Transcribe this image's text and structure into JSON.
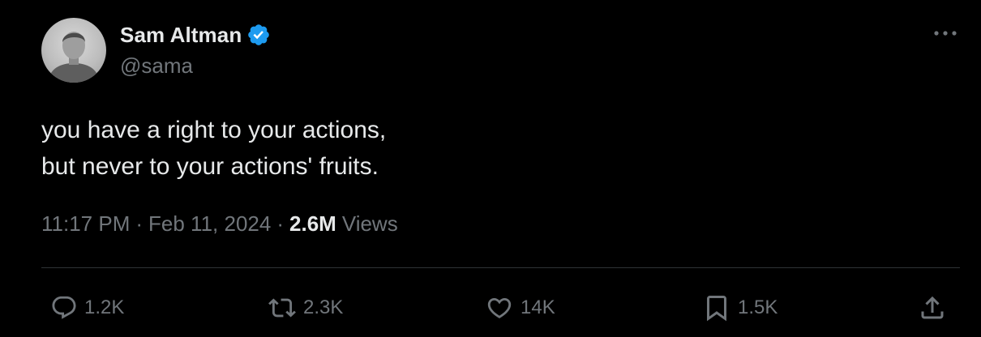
{
  "author": {
    "display_name": "Sam Altman",
    "handle": "@sama",
    "verified": true
  },
  "tweet": {
    "text": "you have a right to your actions,\nbut never to your actions' fruits."
  },
  "meta": {
    "time": "11:17 PM",
    "separator": "·",
    "date": "Feb 11, 2024",
    "views_count": "2.6M",
    "views_label": "Views"
  },
  "actions": {
    "replies": "1.2K",
    "retweets": "2.3K",
    "likes": "14K",
    "bookmarks": "1.5K"
  },
  "colors": {
    "background": "#000000",
    "text": "#e7e9ea",
    "muted": "#71767b",
    "verified_badge": "#1d9bf0",
    "divider": "#2f3336"
  },
  "icons": {
    "verified": "verified-badge-icon",
    "more": "more-options-icon",
    "reply": "reply-bubble-icon",
    "retweet": "retweet-arrows-icon",
    "like": "heart-icon",
    "bookmark": "bookmark-icon",
    "share": "share-upload-icon"
  }
}
